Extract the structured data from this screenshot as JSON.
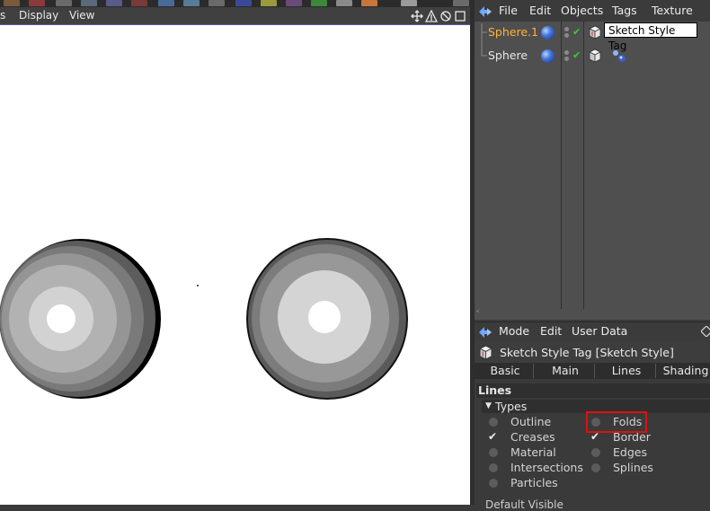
{
  "viewport": {
    "menu": [
      "s",
      "Display",
      "View"
    ]
  },
  "object_manager": {
    "menu": [
      "File",
      "Edit",
      "Objects",
      "Tags",
      "Texture"
    ],
    "objects": [
      {
        "name": "Sphere.1",
        "selected": true
      },
      {
        "name": "Sphere",
        "selected": false
      }
    ],
    "tooltip": "Sketch Style Tag"
  },
  "attribute_manager": {
    "menu": [
      "Mode",
      "Edit",
      "User Data"
    ],
    "title": "Sketch Style Tag [Sketch Style]",
    "tabs": [
      "Basic",
      "Main",
      "Lines",
      "Shading"
    ],
    "section": "Lines",
    "group": "Types",
    "options_left": [
      {
        "label": "Outline",
        "checked": false
      },
      {
        "label": "Creases",
        "checked": true
      },
      {
        "label": "Material",
        "checked": false
      },
      {
        "label": "Intersections",
        "checked": false
      },
      {
        "label": "Particles",
        "checked": false
      }
    ],
    "options_right": [
      {
        "label": "Folds",
        "checked": false
      },
      {
        "label": "Border",
        "checked": true
      },
      {
        "label": "Edges",
        "checked": false
      },
      {
        "label": "Splines",
        "checked": false
      }
    ],
    "footer_partial": "Default Visible"
  },
  "colors": {
    "accent_selected": "#ffb23e",
    "highlight_box": "#e01010"
  }
}
